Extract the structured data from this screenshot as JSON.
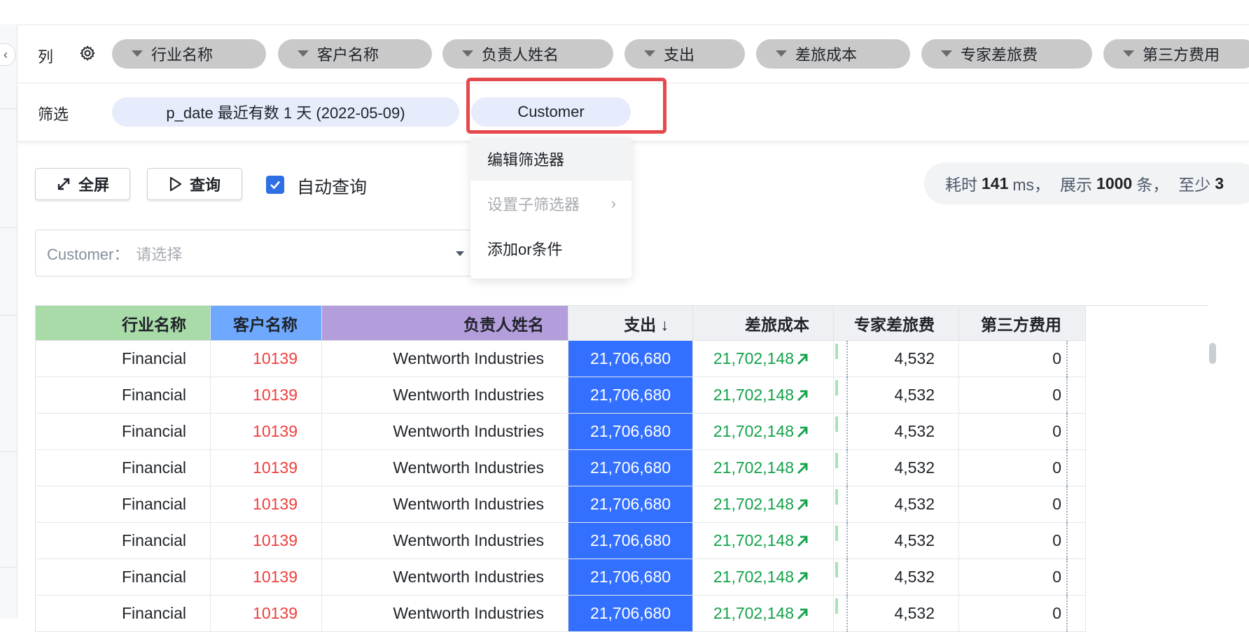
{
  "columns_row": {
    "label": "列",
    "pills": [
      "行业名称",
      "客户名称",
      "负责人姓名",
      "支出",
      "差旅成本",
      "专家差旅费",
      "第三方费用"
    ]
  },
  "filter_row": {
    "label": "筛选",
    "date_filter": "p_date 最近有数 1 天 (2022-05-09)",
    "customer_filter": "Customer"
  },
  "context_menu": {
    "items": [
      "编辑筛选器",
      "设置子筛选器",
      "添加or条件"
    ]
  },
  "toolbar": {
    "fullscreen_label": "全屏",
    "query_label": "查询",
    "auto_query_label": "自动查询",
    "auto_query_checked": true
  },
  "stats": {
    "time_prefix": "耗时",
    "time_value": "141",
    "time_unit": "ms，",
    "show_prefix": "展示",
    "show_value": "1000",
    "show_unit": "条，",
    "least_prefix": "至少",
    "least_value": "3"
  },
  "customer_select": {
    "label": "Customer：",
    "placeholder": "请选择"
  },
  "table": {
    "headers": [
      "行业名称",
      "客户名称",
      "负责人姓名",
      "支出 ↓",
      "差旅成本",
      "专家差旅费",
      "第三方费用"
    ],
    "header_colors": [
      "#a8dba8",
      "#6ea8ff",
      "#b39ddb",
      "#eef0f3",
      "#eef0f3",
      "#eef0f3",
      "#eef0f3"
    ],
    "rows": [
      [
        "Financial",
        "10139",
        "Wentworth Industries",
        "21,706,680",
        "21,702,148",
        "4,532",
        "0"
      ],
      [
        "Financial",
        "10139",
        "Wentworth Industries",
        "21,706,680",
        "21,702,148",
        "4,532",
        "0"
      ],
      [
        "Financial",
        "10139",
        "Wentworth Industries",
        "21,706,680",
        "21,702,148",
        "4,532",
        "0"
      ],
      [
        "Financial",
        "10139",
        "Wentworth Industries",
        "21,706,680",
        "21,702,148",
        "4,532",
        "0"
      ],
      [
        "Financial",
        "10139",
        "Wentworth Industries",
        "21,706,680",
        "21,702,148",
        "4,532",
        "0"
      ],
      [
        "Financial",
        "10139",
        "Wentworth Industries",
        "21,706,680",
        "21,702,148",
        "4,532",
        "0"
      ],
      [
        "Financial",
        "10139",
        "Wentworth Industries",
        "21,706,680",
        "21,702,148",
        "4,532",
        "0"
      ],
      [
        "Financial",
        "10139",
        "Wentworth Industries",
        "21,706,680",
        "21,702,148",
        "4,532",
        "0"
      ]
    ]
  },
  "colors": {
    "accent_blue": "#3370ff",
    "highlight_red": "#e5484d",
    "positive_green": "#13a24a",
    "customer_id_red": "#f03e3e"
  }
}
